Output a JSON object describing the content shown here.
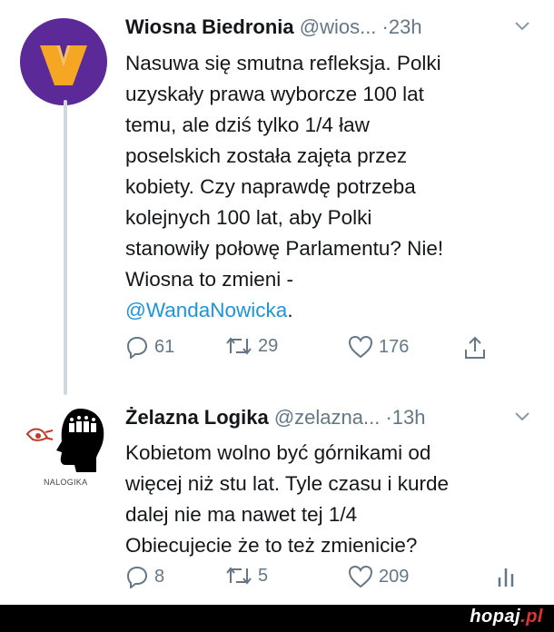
{
  "tweets": [
    {
      "name": "Wiosna Biedronia",
      "handle": "@wios...",
      "dot": "·",
      "time": "23h",
      "text_lines": [
        "Nasuwa się smutna refleksja. Polki",
        "uzyskały prawa wyborcze 100 lat",
        "temu, ale dziś tylko 1/4 ław",
        "poselskich została zajęta przez",
        "kobiety. Czy naprawdę potrzeba",
        "kolejnych 100 lat, aby Polki",
        "stanowiły połowę Parlamentu? Nie!",
        "Wiosna to zmieni -"
      ],
      "mention": "@WandaNowicka",
      "mention_tail": ".",
      "replies": "61",
      "retweets": "29",
      "likes": "176"
    },
    {
      "name": "Żelazna Logika",
      "handle": "@zelazna...",
      "dot": "·",
      "time": "13h",
      "avatar_label": "NALOGIKA",
      "text_lines": [
        "Kobietom wolno być górnikami od",
        "więcej niż stu lat. Tyle czasu i kurde",
        "dalej nie ma nawet tej 1/4",
        "Obiecujecie że to też zmienicie?"
      ],
      "replies": "8",
      "retweets": "5",
      "likes": "209"
    }
  ],
  "watermark": {
    "name": "hopaj",
    "tld": ".pl"
  },
  "colors": {
    "accent": "#1b95e0",
    "avatar_bg": "#5b2a98",
    "logo_orange": "#f5a623"
  }
}
